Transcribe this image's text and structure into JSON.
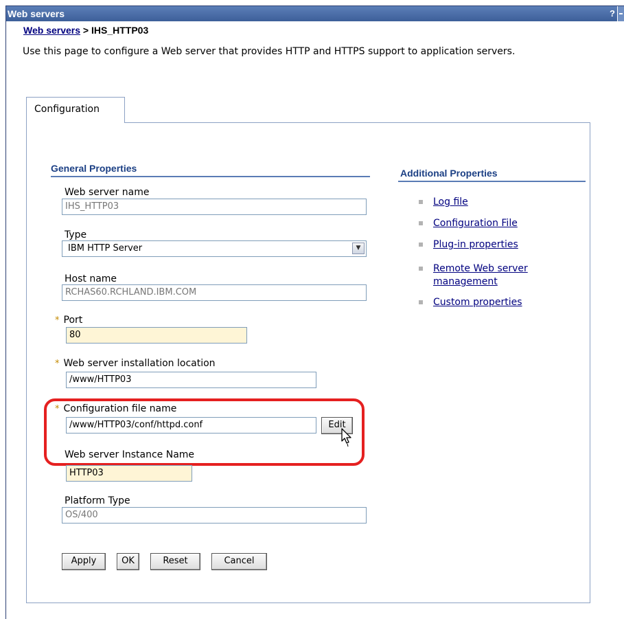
{
  "window": {
    "title": "Web servers",
    "help_glyph": "?"
  },
  "breadcrumb": {
    "link": "Web servers",
    "separator": " > ",
    "current": "IHS_HTTP03"
  },
  "description": "Use this page to configure a Web server that provides HTTP and HTTPS support to application servers.",
  "tab": {
    "label": "Configuration"
  },
  "general": {
    "title": "General Properties",
    "web_server_name": {
      "label": "Web server name",
      "value": "IHS_HTTP03"
    },
    "type": {
      "label": "Type",
      "value": "IBM HTTP Server"
    },
    "host_name": {
      "label": "Host name",
      "value": "RCHAS60.RCHLAND.IBM.COM"
    },
    "port": {
      "label": "Port",
      "value": "80",
      "required": "*"
    },
    "install_location": {
      "label": "Web server installation location",
      "value": "/www/HTTP03",
      "required": "*"
    },
    "config_file": {
      "label": "Configuration file name",
      "value": "/www/HTTP03/conf/httpd.conf",
      "required": "*",
      "edit_label": "Edit"
    },
    "instance_name": {
      "label": "Web server Instance Name",
      "value": "HTTP03"
    },
    "platform_type": {
      "label": "Platform Type",
      "value": "OS/400"
    }
  },
  "additional": {
    "title": "Additional Properties",
    "links": [
      "Log file",
      "Configuration File",
      "Plug-in properties",
      "Remote Web server",
      "management",
      "Custom properties"
    ]
  },
  "buttons": {
    "apply": "Apply",
    "ok": "OK",
    "reset": "Reset",
    "cancel": "Cancel"
  },
  "colors": {
    "titlebar": "#4a6ba6",
    "link": "#00007f",
    "highlight": "#e52020",
    "required_field_bg": "#fef5d6"
  },
  "icons": [
    "help-icon",
    "minimize-icon",
    "dropdown-arrow-icon",
    "mouse-cursor-icon"
  ]
}
